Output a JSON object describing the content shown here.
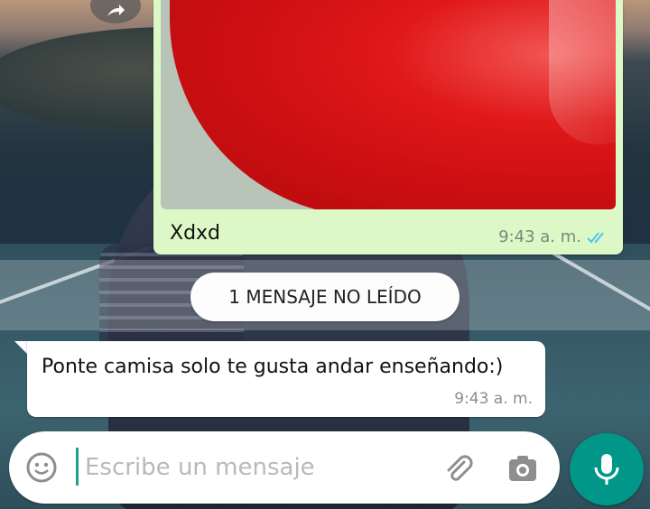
{
  "chat": {
    "outgoing_image_message": {
      "caption": "Xdxd",
      "time": "9:43 a. m.",
      "status": "read-double-tick",
      "tick_color": "#4fc3f7"
    },
    "unread_divider": {
      "label": "1 MENSAJE NO LEÍDO"
    },
    "incoming_message": {
      "text": "Ponte camisa solo te gusta andar enseñando:)",
      "time": "9:43 a. m."
    }
  },
  "composer": {
    "placeholder": "Escribe un mensaje",
    "value": "",
    "icons": [
      "emoji-icon",
      "attach-clip-icon",
      "camera-icon",
      "microphone-icon"
    ],
    "accent_color": "#009688"
  },
  "colors": {
    "outgoing_bubble": "#dcf8c6",
    "incoming_bubble": "#ffffff",
    "heart_red": "#e01818"
  }
}
